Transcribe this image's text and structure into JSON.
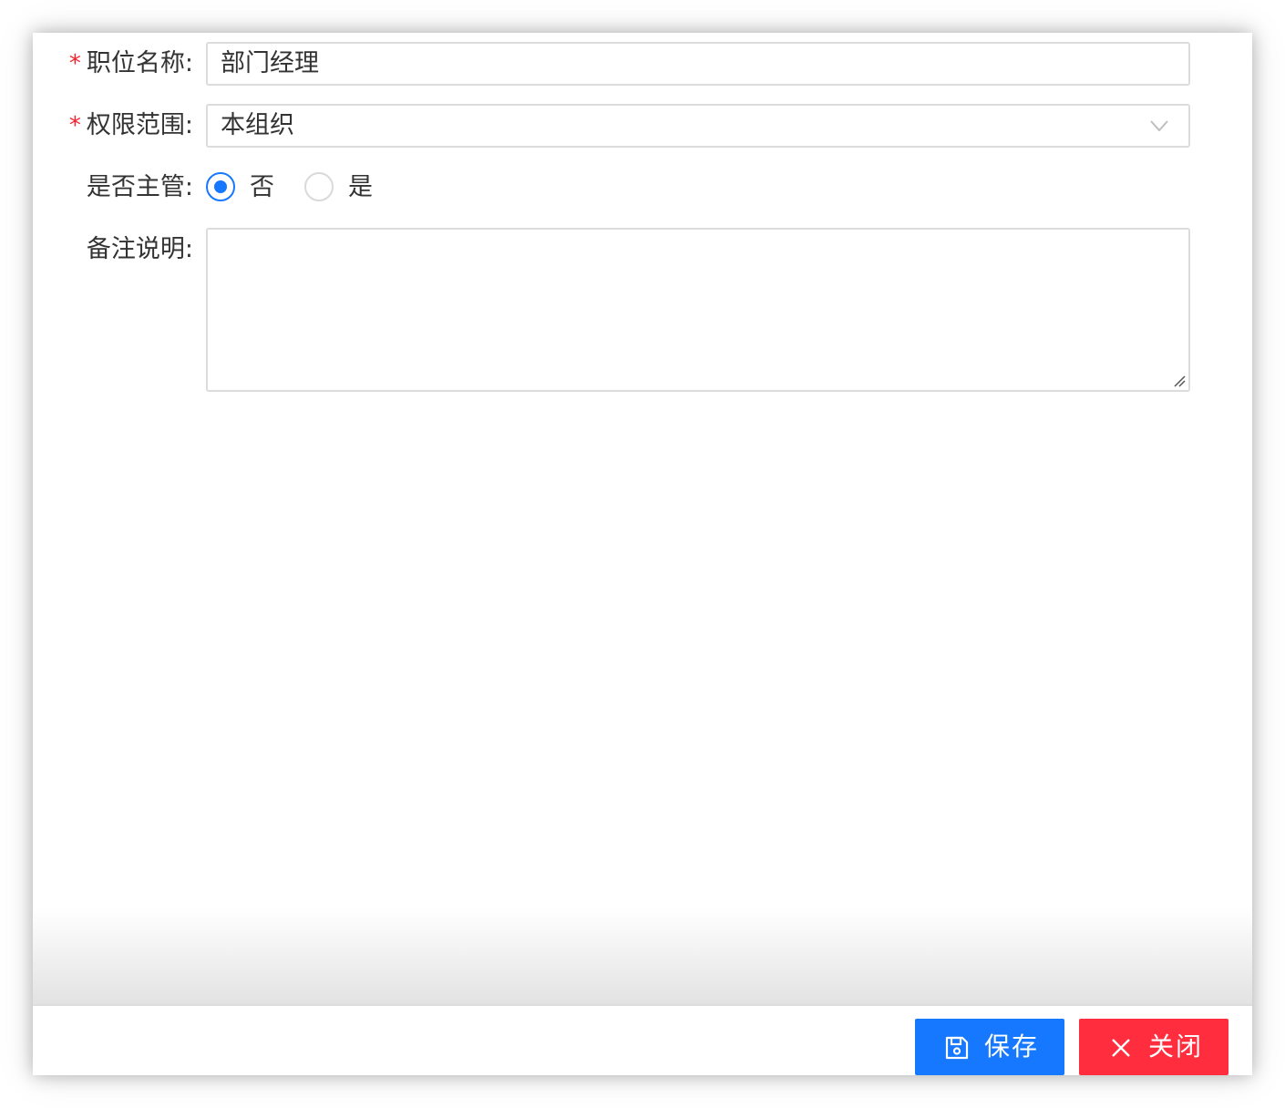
{
  "form": {
    "position_name": {
      "label": "职位名称:",
      "required_mark": "*",
      "value": "部门经理"
    },
    "permission_scope": {
      "label": "权限范围:",
      "required_mark": "*",
      "value": "本组织"
    },
    "is_supervisor": {
      "label": "是否主管:",
      "options": [
        {
          "label": "否",
          "checked": true
        },
        {
          "label": "是",
          "checked": false
        }
      ]
    },
    "remarks": {
      "label": "备注说明:",
      "value": ""
    }
  },
  "footer": {
    "save_label": "保存",
    "close_label": "关闭"
  },
  "colors": {
    "primary": "#1677ff",
    "danger": "#ff2d3d",
    "required": "#f5222d"
  }
}
